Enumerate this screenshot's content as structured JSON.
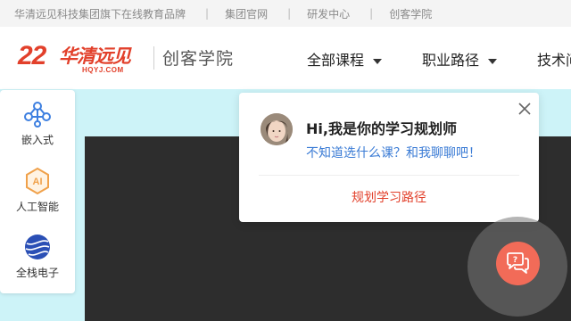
{
  "topbar": {
    "links": [
      "华清远见科技集团旗下在线教育品牌",
      "集团官网",
      "研发中心",
      "创客学院"
    ],
    "separator": "|"
  },
  "header": {
    "logo_number": "22",
    "logo_cn": "华清远见",
    "logo_en": "HQYJ.COM",
    "brand": "创客学院",
    "nav": [
      "全部课程",
      "职业路径",
      "技术问"
    ]
  },
  "sidebar": {
    "items": [
      {
        "label": "嵌入式",
        "icon": "embedded-icon"
      },
      {
        "label": "人工智能",
        "icon": "ai-icon"
      },
      {
        "label": "全栈电子",
        "icon": "globe-icon"
      }
    ]
  },
  "popup": {
    "title": "Hi,我是你的学习规划师",
    "subtitle": "不知道选什么课？和我聊聊吧！",
    "cta": "规划学习路径"
  },
  "colors": {
    "brand_red": "#e2402b",
    "link_blue": "#3a7bd5",
    "chat_button": "#f26b58",
    "hero_dark": "#2d2d2d",
    "page_bg": "#cdf3f8"
  }
}
